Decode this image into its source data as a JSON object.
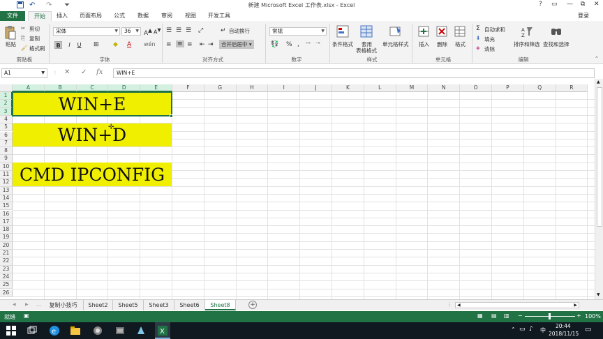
{
  "titlebar": {
    "title": "新建 Microsoft Excel 工作表.xlsx - Excel",
    "controls": [
      "?",
      "▭",
      "—",
      "⧉",
      "✕"
    ]
  },
  "ribbon_tabs": {
    "file": "文件",
    "tabs": [
      "开始",
      "插入",
      "页面布局",
      "公式",
      "数据",
      "审阅",
      "视图",
      "开发工具"
    ],
    "login": "登录"
  },
  "ribbon": {
    "paste": "粘贴",
    "cut": "剪切",
    "copy": "复制",
    "format_painter": "格式刷",
    "clipboard_label": "剪贴板",
    "font_name": "宋体",
    "font_size": "36",
    "bold": "B",
    "italic": "I",
    "underline": "U",
    "font_label": "字体",
    "wrap_text": "自动换行",
    "merge_center": "合并后居中",
    "align_label": "对齐方式",
    "number_format": "常规",
    "percent": "%",
    "comma": ",",
    "number_label": "数字",
    "cond_format": "条件格式",
    "table_format": "套用",
    "table_format2": "表格格式",
    "cell_style": "单元格样式",
    "style_label": "样式",
    "insert": "插入",
    "delete": "删除",
    "format": "格式",
    "cells_label": "单元格",
    "autosum": "自动求和",
    "fill": "填充",
    "clear": "清除",
    "sort_filter": "排序和筛选",
    "find_select": "查找和选择",
    "edit_label": "编辑"
  },
  "formula_bar": {
    "name_box": "A1",
    "fx": "fx",
    "formula": "WIN+E"
  },
  "grid": {
    "columns": [
      "A",
      "B",
      "C",
      "D",
      "E",
      "F",
      "G",
      "H",
      "I",
      "J",
      "K",
      "L",
      "M",
      "N",
      "O",
      "P",
      "Q",
      "R"
    ],
    "rows": [
      "1",
      "2",
      "3",
      "4",
      "5",
      "6",
      "7",
      "8",
      "9",
      "10",
      "11",
      "12",
      "13",
      "14",
      "15",
      "16",
      "17",
      "18",
      "19",
      "20",
      "21",
      "22",
      "23",
      "24",
      "25",
      "26"
    ],
    "merged_cells": [
      {
        "text": "WIN+E"
      },
      {
        "text": "WIN+D"
      },
      {
        "text": "CMD IPCONFIG"
      }
    ],
    "fill_color": "#f0ef00",
    "selection_color": "#217346"
  },
  "sheets": {
    "tabs": [
      "复制小技巧",
      "Sheet2",
      "Sheet5",
      "Sheet3",
      "Sheet6",
      "Sheet8"
    ],
    "active": "Sheet8",
    "add": "+"
  },
  "statusbar": {
    "ready": "就绪",
    "zoom": "100%"
  },
  "taskbar": {
    "time": "20:44",
    "date": "2018/11/15",
    "ime": "中"
  }
}
